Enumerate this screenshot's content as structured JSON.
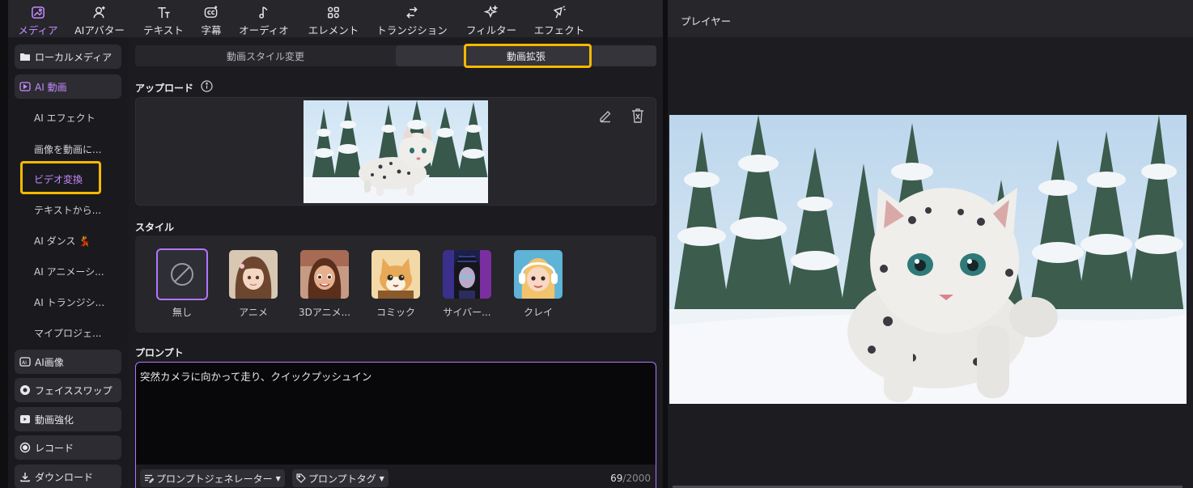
{
  "toolbar": {
    "items": [
      {
        "label": "メディア",
        "icon": "media-icon",
        "active": true
      },
      {
        "label": "AIアバター",
        "icon": "avatar-icon"
      },
      {
        "label": "テキスト",
        "icon": "text-icon"
      },
      {
        "label": "字幕",
        "icon": "caption-icon"
      },
      {
        "label": "オーディオ",
        "icon": "audio-icon"
      },
      {
        "label": "エレメント",
        "icon": "element-icon"
      },
      {
        "label": "トランジション",
        "icon": "transition-icon"
      },
      {
        "label": "フィルター",
        "icon": "filter-icon"
      },
      {
        "label": "エフェクト",
        "icon": "effect-icon"
      }
    ]
  },
  "sidebar": {
    "categories": [
      {
        "label": "ローカルメディア",
        "icon": "folder-icon"
      },
      {
        "label": "AI 動画",
        "icon": "ai-video-icon",
        "active": true
      },
      {
        "label": "AI画像",
        "icon": "ai-image-icon"
      },
      {
        "label": "フェイススワップ",
        "icon": "face-swap-icon"
      },
      {
        "label": "動画強化",
        "icon": "video-enhance-icon"
      },
      {
        "label": "レコード",
        "icon": "record-icon"
      },
      {
        "label": "ダウンロード",
        "icon": "download-icon"
      }
    ],
    "subitems": [
      {
        "label": "AI エフェクト"
      },
      {
        "label": "画像を動画に..."
      },
      {
        "label": "ビデオ変換",
        "active": true
      },
      {
        "label": "テキストから..."
      },
      {
        "label": "AI ダンス 💃"
      },
      {
        "label": "AI アニメーシ..."
      },
      {
        "label": "AI トランジシ..."
      },
      {
        "label": "マイプロジェ..."
      }
    ]
  },
  "tabs": [
    {
      "label": "動画スタイル変更"
    },
    {
      "label": "動画拡張",
      "active": true
    }
  ],
  "upload": {
    "title": "アップロード"
  },
  "style": {
    "title": "スタイル",
    "items": [
      {
        "label": "無し",
        "selected": true
      },
      {
        "label": "アニメ"
      },
      {
        "label": "3Dアニメ..."
      },
      {
        "label": "コミック"
      },
      {
        "label": "サイバー..."
      },
      {
        "label": "クレイ"
      }
    ]
  },
  "prompt": {
    "title": "プロンプト",
    "value": "突然カメラに向かって走り、クイックプッシュイン",
    "generator_label": "プロンプトジェネレーター",
    "tag_label": "プロンプトタグ",
    "count": "69",
    "max": "/2000"
  },
  "player": {
    "title": "プレイヤー"
  },
  "colors": {
    "accent": "#b574ff",
    "highlight": "#f6b800",
    "panel": "#1c1c21"
  }
}
